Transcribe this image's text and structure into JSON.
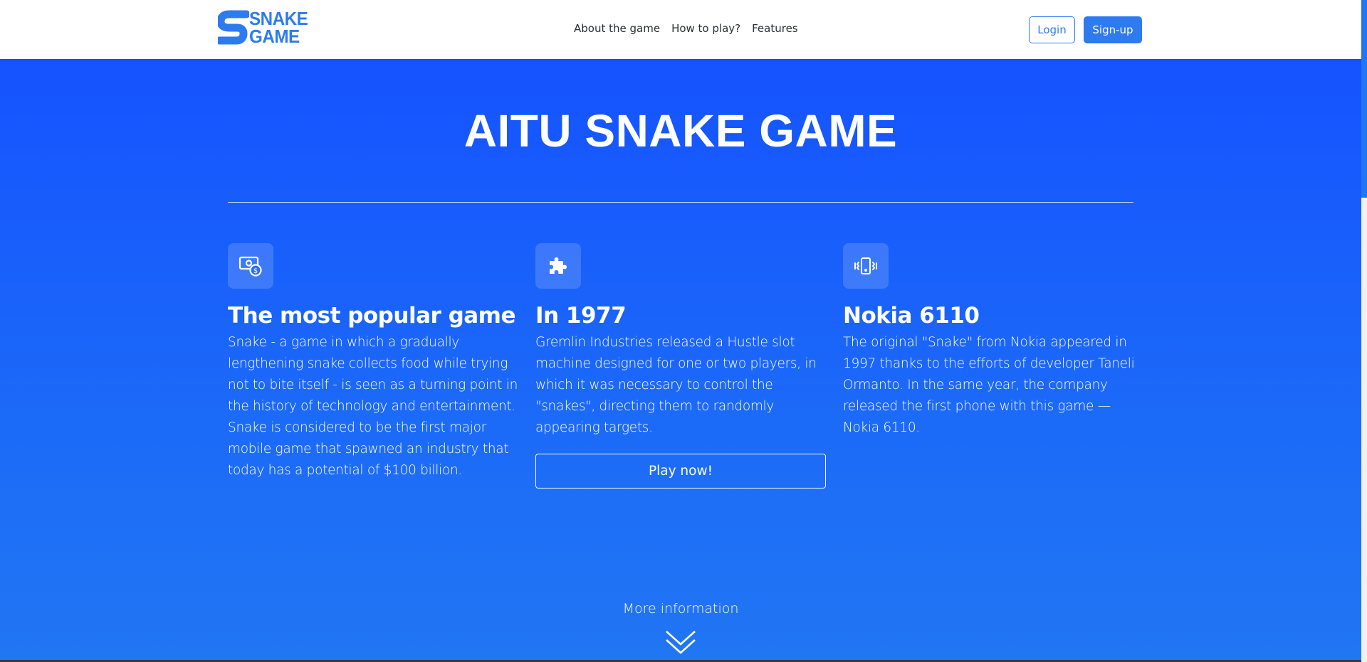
{
  "header": {
    "logo_line1": "SNAKE",
    "logo_line2": "GAME",
    "nav": [
      {
        "label": "About the game"
      },
      {
        "label": "How to play?"
      },
      {
        "label": "Features"
      }
    ],
    "login_label": "Login",
    "signup_label": "Sign-up"
  },
  "hero": {
    "title": "AITU SNAKE GAME",
    "features": [
      {
        "icon": "money-icon",
        "title": "The most popular game",
        "text": "Snake - a game in which a gradually lengthening snake collects food while trying not to bite itself - is seen as a turning point in the history of technology and entertainment. Snake is considered to be the first major mobile game that spawned an industry that today has a potential of $100 billion."
      },
      {
        "icon": "puzzle-icon",
        "title": "In 1977",
        "text": "Gremlin Industries released a Hustle slot machine designed for one or two players, in which it was necessary to control the \"snakes\", directing them to randomly appearing targets."
      },
      {
        "icon": "phone-vibrate-icon",
        "title": "Nokia 6110",
        "text": "The original \"Snake\" from Nokia appeared in 1997 thanks to the efforts of developer Taneli Ormanto. In the same year, the company released the first phone with this game — Nokia 6110."
      }
    ],
    "play_label": "Play now!",
    "more_label": "More information"
  },
  "colors": {
    "accent": "#2e7bf0",
    "hero_top": "#1553ff",
    "hero_bottom": "#2176f3",
    "text_on_hero": "#ffffff"
  }
}
